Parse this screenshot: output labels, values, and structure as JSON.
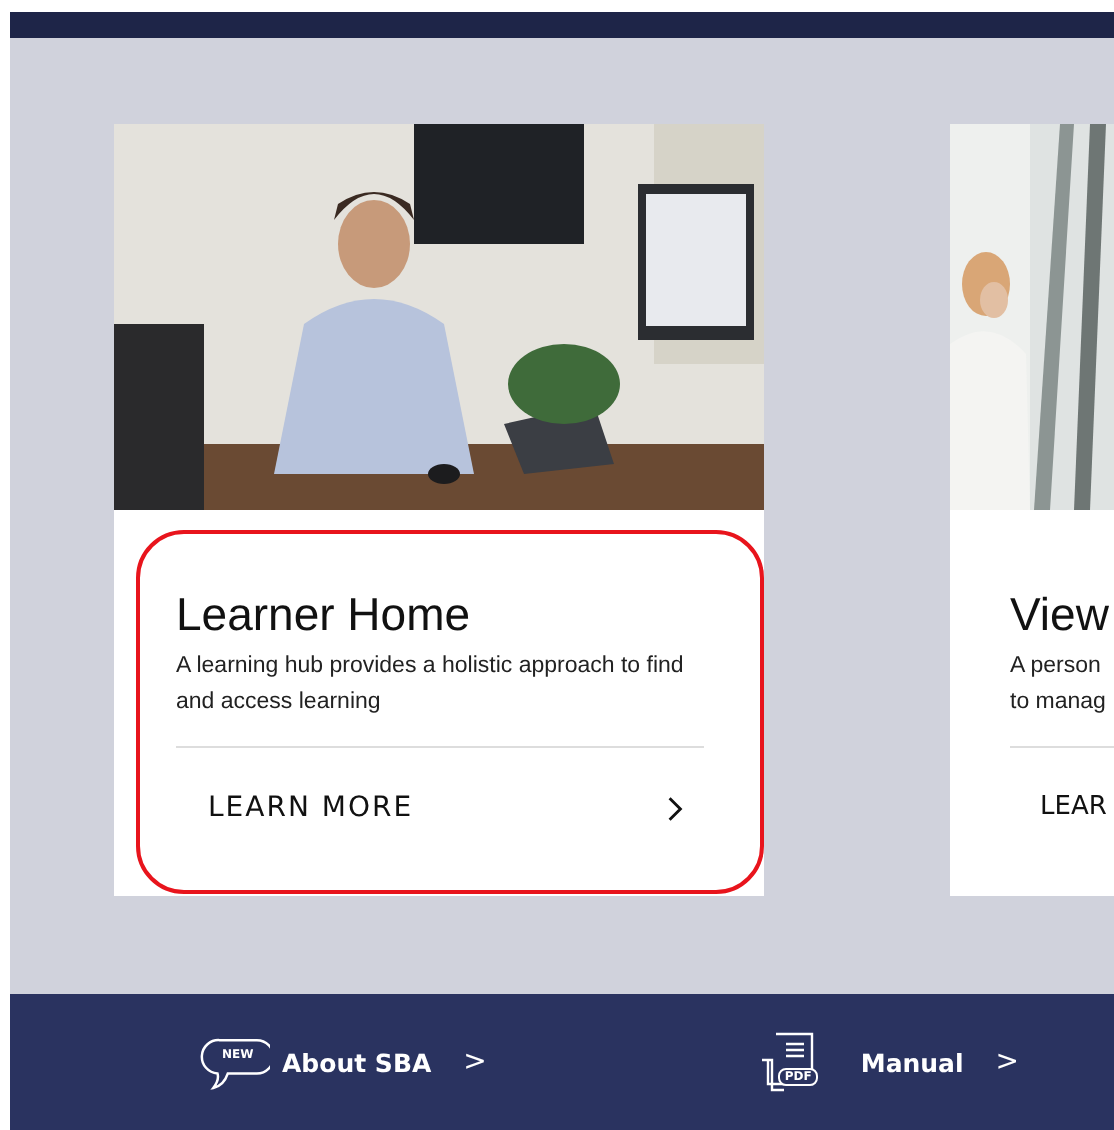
{
  "cards": [
    {
      "title": "Learner Home",
      "description": "A learning hub provides a holistic approach to find and access learning",
      "link": "LEARN MORE",
      "highlighted": true
    },
    {
      "title": "View",
      "description_lines": [
        "A person",
        "to manag"
      ],
      "link": "LEAR",
      "highlighted": false
    }
  ],
  "footer": [
    {
      "badge": "NEW",
      "label": "About SBA",
      "chevron": ">"
    },
    {
      "badge": "PDF",
      "label": "Manual",
      "chevron": ">"
    }
  ]
}
